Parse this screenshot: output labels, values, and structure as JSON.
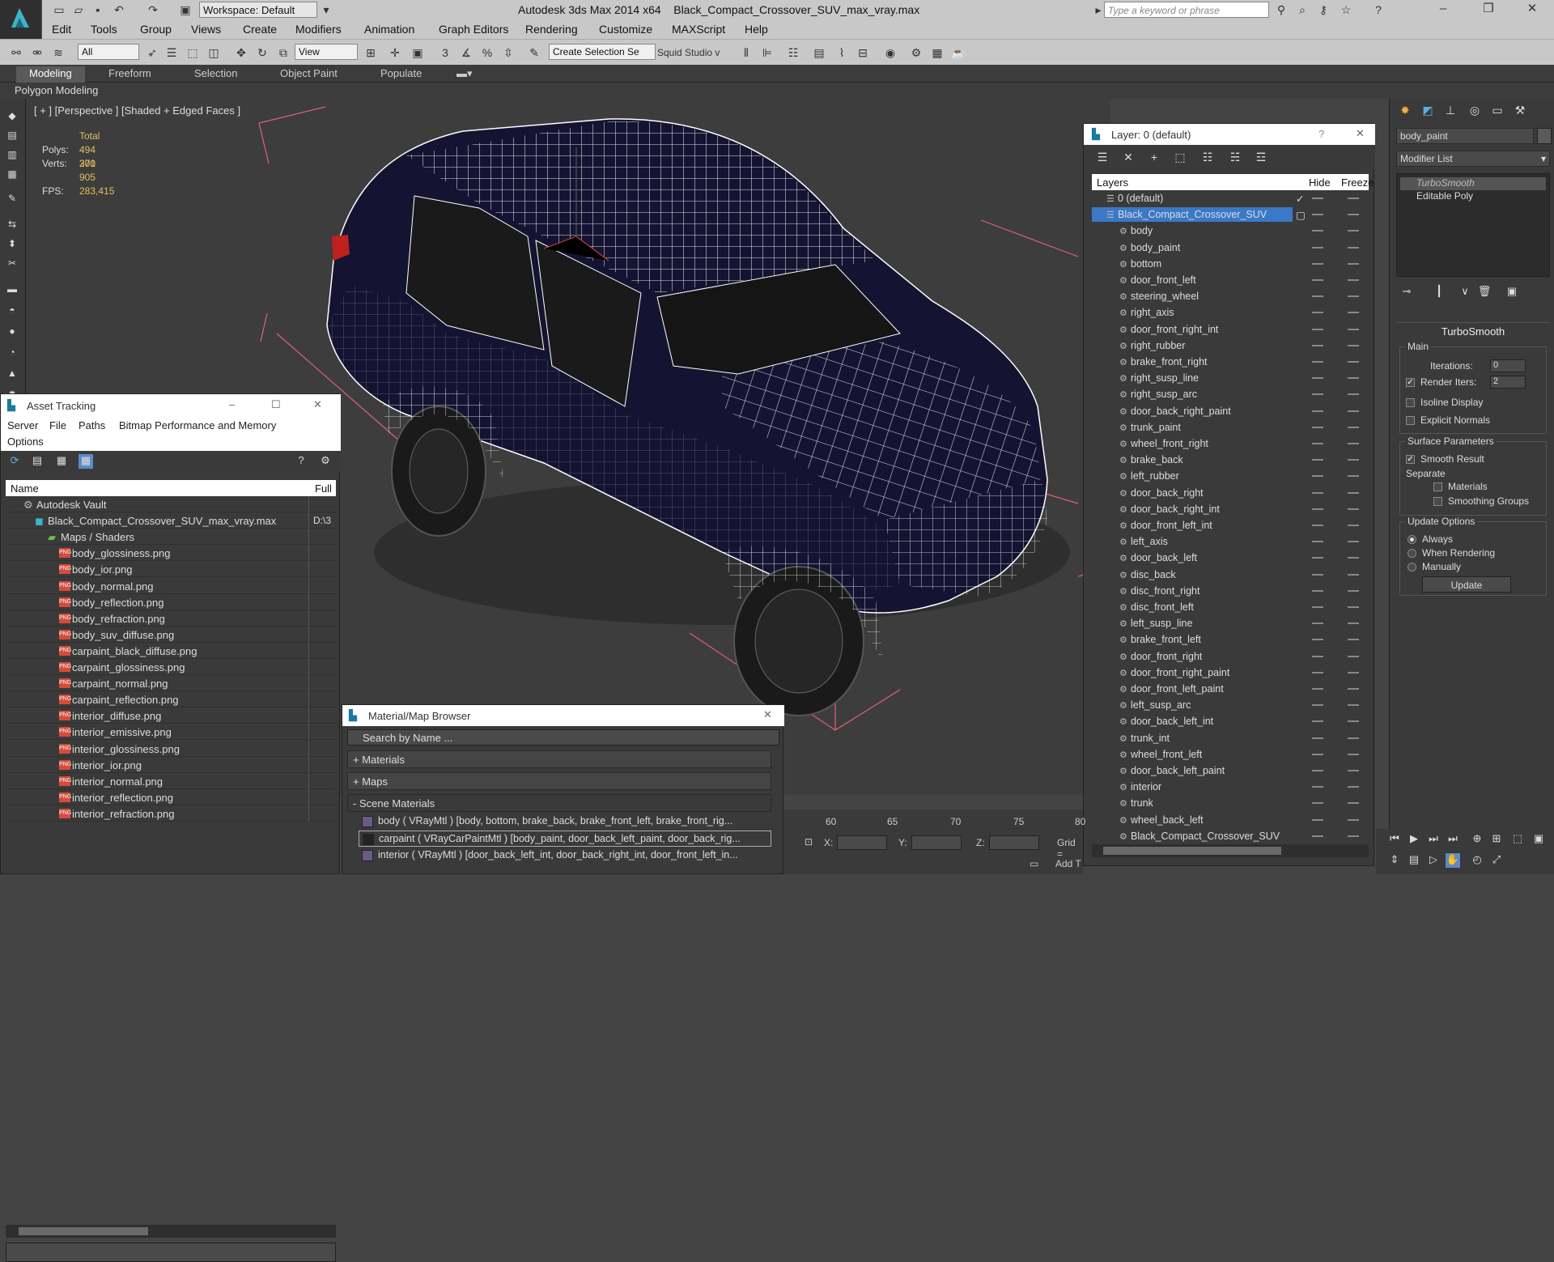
{
  "app": {
    "title": "Autodesk 3ds Max  2014 x64",
    "file_title": "Black_Compact_Crossover_SUV_max_vray.max",
    "workspace": "Workspace: Default",
    "search_placeholder": "Type a keyword or phrase"
  },
  "menu": [
    "Edit",
    "Tools",
    "Group",
    "Views",
    "Create",
    "Modifiers",
    "Animation",
    "Graph Editors",
    "Rendering",
    "Customize",
    "MAXScript",
    "Help"
  ],
  "toolbar": {
    "filter": "All",
    "ref_coord": "View",
    "selection_set": "Create Selection Se",
    "squid": "Squid Studio v"
  },
  "ribbon": {
    "tabs": [
      "Modeling",
      "Freeform",
      "Selection",
      "Object Paint",
      "Populate"
    ],
    "sub": "Polygon Modeling"
  },
  "viewport": {
    "label": "[ + ] [Perspective ] [Shaded + Edged Faces ]",
    "stats": {
      "total": "Total",
      "polys_label": "Polys:",
      "polys": "494 300",
      "verts_label": "Verts:",
      "verts": "271 905",
      "fps_label": "FPS:",
      "fps": "283,415"
    }
  },
  "command_panel": {
    "object_name": "body_paint",
    "modifier_list": "Modifier List",
    "stack": [
      "TurboSmooth",
      "Editable Poly"
    ],
    "rollout": "TurboSmooth",
    "main_group": "Main",
    "iterations_label": "Iterations:",
    "iterations": "0",
    "render_iters_label": "Render Iters:",
    "render_iters": "2",
    "isoline": "Isoline Display",
    "explicit_normals": "Explicit Normals",
    "surface_group": "Surface Parameters",
    "smooth_result": "Smooth Result",
    "separate": "Separate",
    "materials": "Materials",
    "smoothing_groups": "Smoothing Groups",
    "update_group": "Update Options",
    "always": "Always",
    "when_rendering": "When Rendering",
    "manually": "Manually",
    "update_btn": "Update"
  },
  "layer_window": {
    "title": "Layer: 0 (default)",
    "help": "?",
    "col_layers": "Layers",
    "col_hide": "Hide",
    "col_freeze": "Freeze",
    "rows": [
      {
        "name": "0 (default)",
        "level": 0
      },
      {
        "name": "Black_Compact_Crossover_SUV",
        "level": 0,
        "selected": true
      },
      {
        "name": "body",
        "level": 1
      },
      {
        "name": "body_paint",
        "level": 1
      },
      {
        "name": "bottom",
        "level": 1
      },
      {
        "name": "door_front_left",
        "level": 1
      },
      {
        "name": "steering_wheel",
        "level": 1
      },
      {
        "name": "right_axis",
        "level": 1
      },
      {
        "name": "door_front_right_int",
        "level": 1
      },
      {
        "name": "right_rubber",
        "level": 1
      },
      {
        "name": "brake_front_right",
        "level": 1
      },
      {
        "name": "right_susp_line",
        "level": 1
      },
      {
        "name": "right_susp_arc",
        "level": 1
      },
      {
        "name": "door_back_right_paint",
        "level": 1
      },
      {
        "name": "trunk_paint",
        "level": 1
      },
      {
        "name": "wheel_front_right",
        "level": 1
      },
      {
        "name": "brake_back",
        "level": 1
      },
      {
        "name": "left_rubber",
        "level": 1
      },
      {
        "name": "door_back_right",
        "level": 1
      },
      {
        "name": "door_back_right_int",
        "level": 1
      },
      {
        "name": "door_front_left_int",
        "level": 1
      },
      {
        "name": "left_axis",
        "level": 1
      },
      {
        "name": "door_back_left",
        "level": 1
      },
      {
        "name": "disc_back",
        "level": 1
      },
      {
        "name": "disc_front_right",
        "level": 1
      },
      {
        "name": "disc_front_left",
        "level": 1
      },
      {
        "name": "left_susp_line",
        "level": 1
      },
      {
        "name": "brake_front_left",
        "level": 1
      },
      {
        "name": "door_front_right",
        "level": 1
      },
      {
        "name": "door_front_right_paint",
        "level": 1
      },
      {
        "name": "door_front_left_paint",
        "level": 1
      },
      {
        "name": "left_susp_arc",
        "level": 1
      },
      {
        "name": "door_back_left_int",
        "level": 1
      },
      {
        "name": "trunk_int",
        "level": 1
      },
      {
        "name": "wheel_front_left",
        "level": 1
      },
      {
        "name": "door_back_left_paint",
        "level": 1
      },
      {
        "name": "interior",
        "level": 1
      },
      {
        "name": "trunk",
        "level": 1
      },
      {
        "name": "wheel_back_left",
        "level": 1
      },
      {
        "name": "Black_Compact_Crossover_SUV",
        "level": 1
      }
    ]
  },
  "asset_window": {
    "title": "Asset Tracking",
    "menu": [
      "Server",
      "File",
      "Paths",
      "Bitmap Performance and Memory",
      "Options"
    ],
    "col_name": "Name",
    "col_full": "Full",
    "rows": [
      {
        "name": "Autodesk Vault",
        "level": 0,
        "full": ""
      },
      {
        "name": "Black_Compact_Crossover_SUV_max_vray.max",
        "level": 1,
        "full": "D:\\3"
      },
      {
        "name": "Maps / Shaders",
        "level": 2,
        "full": ""
      },
      {
        "name": "body_glossiness.png",
        "level": 3,
        "full": ""
      },
      {
        "name": "body_ior.png",
        "level": 3,
        "full": ""
      },
      {
        "name": "body_normal.png",
        "level": 3,
        "full": ""
      },
      {
        "name": "body_reflection.png",
        "level": 3,
        "full": ""
      },
      {
        "name": "body_refraction.png",
        "level": 3,
        "full": ""
      },
      {
        "name": "body_suv_diffuse.png",
        "level": 3,
        "full": ""
      },
      {
        "name": "carpaint_black_diffuse.png",
        "level": 3,
        "full": ""
      },
      {
        "name": "carpaint_glossiness.png",
        "level": 3,
        "full": ""
      },
      {
        "name": "carpaint_normal.png",
        "level": 3,
        "full": ""
      },
      {
        "name": "carpaint_reflection.png",
        "level": 3,
        "full": ""
      },
      {
        "name": "interior_diffuse.png",
        "level": 3,
        "full": ""
      },
      {
        "name": "interior_emissive.png",
        "level": 3,
        "full": ""
      },
      {
        "name": "interior_glossiness.png",
        "level": 3,
        "full": ""
      },
      {
        "name": "interior_ior.png",
        "level": 3,
        "full": ""
      },
      {
        "name": "interior_normal.png",
        "level": 3,
        "full": ""
      },
      {
        "name": "interior_reflection.png",
        "level": 3,
        "full": ""
      },
      {
        "name": "interior_refraction.png",
        "level": 3,
        "full": ""
      }
    ],
    "file_badge": "PNG"
  },
  "material_browser": {
    "title": "Material/Map Browser",
    "search_placeholder": "Search by Name ...",
    "sections": [
      "+ Materials",
      "+ Maps",
      "- Scene Materials"
    ],
    "materials": [
      "body ( VRayMtl ) [body, bottom, brake_back, brake_front_left, brake_front_rig...",
      "carpaint ( VRayCarPaintMtl ) [body_paint, door_back_left_paint, door_back_rig...",
      "interior ( VRayMtl ) [door_back_left_int, door_back_right_int, door_front_left_in..."
    ]
  },
  "timeline": {
    "ticks": [
      "60",
      "65",
      "70",
      "75",
      "80"
    ],
    "x_label": "X:",
    "y_label": "Y:",
    "z_label": "Z:",
    "grid": "Grid =",
    "add_t": "Add T"
  },
  "colors": {
    "wire": "#ffffff",
    "body": "#141432",
    "selection": "#3a78c8",
    "bbox": "#e0607a"
  }
}
